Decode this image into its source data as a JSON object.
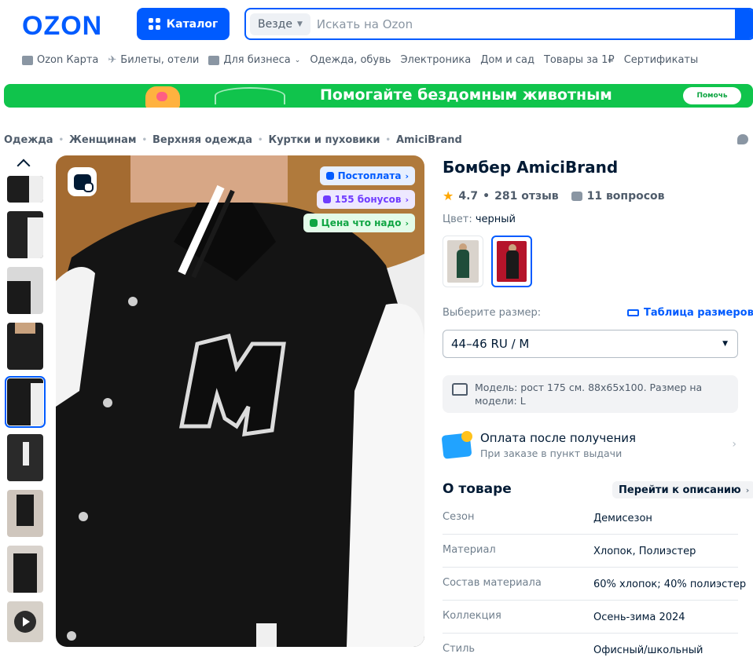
{
  "header": {
    "logo": "OZON",
    "catalog_label": "Каталог",
    "search_scope": "Везде",
    "search_placeholder": "Искать на Ozon"
  },
  "nav": [
    {
      "label": "Ozon Карта",
      "icon": "card-icon"
    },
    {
      "label": "Билеты, отели",
      "icon": "plane-icon"
    },
    {
      "label": "Для бизнеса",
      "icon": "briefcase-icon",
      "has_dropdown": true
    },
    {
      "label": "Одежда, обувь"
    },
    {
      "label": "Электроника"
    },
    {
      "label": "Дом и сад"
    },
    {
      "label": "Товары за 1₽"
    },
    {
      "label": "Сертификаты"
    }
  ],
  "banner": {
    "text": "Помогайте бездомным животным",
    "button": "Помочь",
    "color": "#10c44c"
  },
  "breadcrumbs": [
    "Одежда",
    "Женщинам",
    "Верхняя одежда",
    "Куртки и пуховики",
    "AmiciBrand"
  ],
  "gallery": {
    "thumb_count": 9,
    "active_index": 4,
    "last_is_video": true
  },
  "photo_badges": [
    {
      "label": "Постоплата",
      "style": "blue"
    },
    {
      "label": "155 бонусов",
      "style": "purple"
    },
    {
      "label": "Цена что надо",
      "style": "green"
    }
  ],
  "product": {
    "title": "Бомбер AmiciBrand",
    "rating": "4.7",
    "reviews": "281 отзыв",
    "questions": "11 вопросов",
    "color_label": "Цвет:",
    "color_value": "черный",
    "size_label": "Выберите размер:",
    "size_table_link": "Таблица размеров",
    "selected_size": "44–46 RU / M",
    "model_info": "Модель: рост 175 см. 88х65х100. Размер на модели: L"
  },
  "payment": {
    "title": "Оплата после получения",
    "subtitle": "При заказе в пункт выдачи"
  },
  "about": {
    "title": "О товаре",
    "goto_label": "Перейти к описанию",
    "specs": [
      {
        "key": "Сезон",
        "value": "Демисезон"
      },
      {
        "key": "Материал",
        "value": "Хлопок, Полиэстер"
      },
      {
        "key": "Состав материала",
        "value": "60% хлопок; 40% полиэстер"
      },
      {
        "key": "Коллекция",
        "value": "Осень-зима 2024"
      },
      {
        "key": "Стиль",
        "value": "Офисный/школьный"
      }
    ]
  },
  "colors": {
    "accent": "#005bff",
    "text": "#001a34",
    "muted": "#707f8d"
  }
}
